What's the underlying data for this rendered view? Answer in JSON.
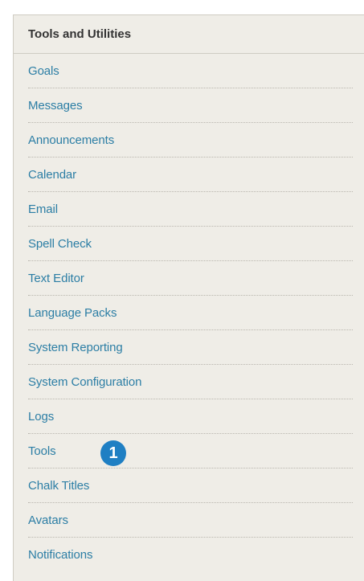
{
  "panel": {
    "title": "Tools and Utilities",
    "items": [
      {
        "label": "Goals"
      },
      {
        "label": "Messages"
      },
      {
        "label": "Announcements"
      },
      {
        "label": "Calendar"
      },
      {
        "label": "Email"
      },
      {
        "label": "Spell Check"
      },
      {
        "label": "Text Editor"
      },
      {
        "label": "Language Packs"
      },
      {
        "label": "System Reporting"
      },
      {
        "label": "System Configuration"
      },
      {
        "label": "Logs"
      },
      {
        "label": "Tools"
      },
      {
        "label": "Chalk Titles"
      },
      {
        "label": "Avatars"
      },
      {
        "label": "Notifications"
      }
    ]
  },
  "callout": {
    "label": "1",
    "color": "#1f7fc3"
  },
  "colors": {
    "link": "#2c7ea5",
    "panel_bg": "#efede7",
    "header_text": "#333333"
  }
}
